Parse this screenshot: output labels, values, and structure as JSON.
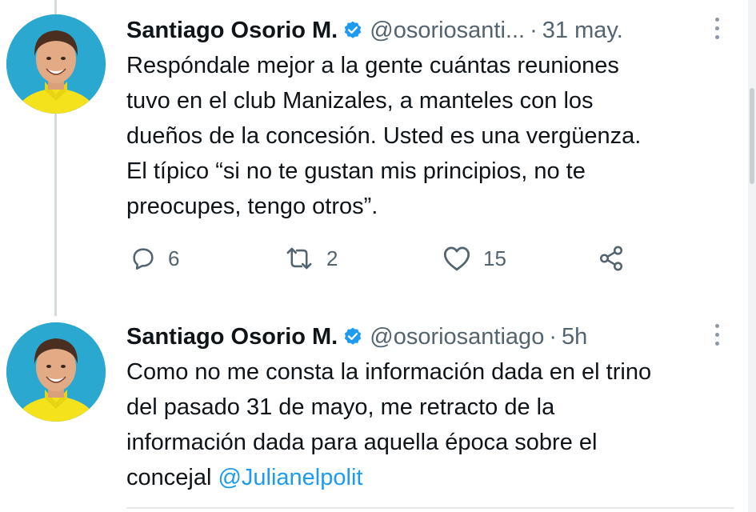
{
  "tweets": [
    {
      "author": {
        "name": "Santiago Osorio M.",
        "handle": "@osoriosanti...",
        "verified_icon": "verified-badge-icon",
        "avatar": "profile-photo"
      },
      "separator": "·",
      "time": "31 may.",
      "text_lines": [
        "Respóndale mejor a la gente cuántas reuniones",
        "tuvo en el club Manizales, a manteles con los",
        "dueños de la concesión. Usted es una vergüenza.",
        "El típico “si no te gustan mis principios, no te",
        "preocupes, tengo otros”."
      ],
      "actions": {
        "replies": {
          "icon": "reply-icon",
          "count": "6"
        },
        "retweets": {
          "icon": "retweet-icon",
          "count": "2"
        },
        "likes": {
          "icon": "heart-icon",
          "count": "15"
        },
        "share": {
          "icon": "share-icon"
        }
      }
    },
    {
      "author": {
        "name": "Santiago Osorio M.",
        "handle": "@osoriosantiago",
        "verified_icon": "verified-badge-icon",
        "avatar": "profile-photo"
      },
      "separator": "·",
      "time": "5h",
      "text_lines": [
        "Como no me consta la información dada en el trino",
        "del pasado 31 de mayo, me retracto de la",
        "información dada para aquella época sobre el"
      ],
      "last_line_prefix": "concejal ",
      "mention": "@Julianelpolit"
    }
  ],
  "colors": {
    "text": "#0f1419",
    "secondary": "#536471",
    "verified": "#1d9bf0",
    "mention": "#1d9bf0",
    "thread_line": "#cfd9de",
    "avatar_bg": "#2aa8cf"
  }
}
